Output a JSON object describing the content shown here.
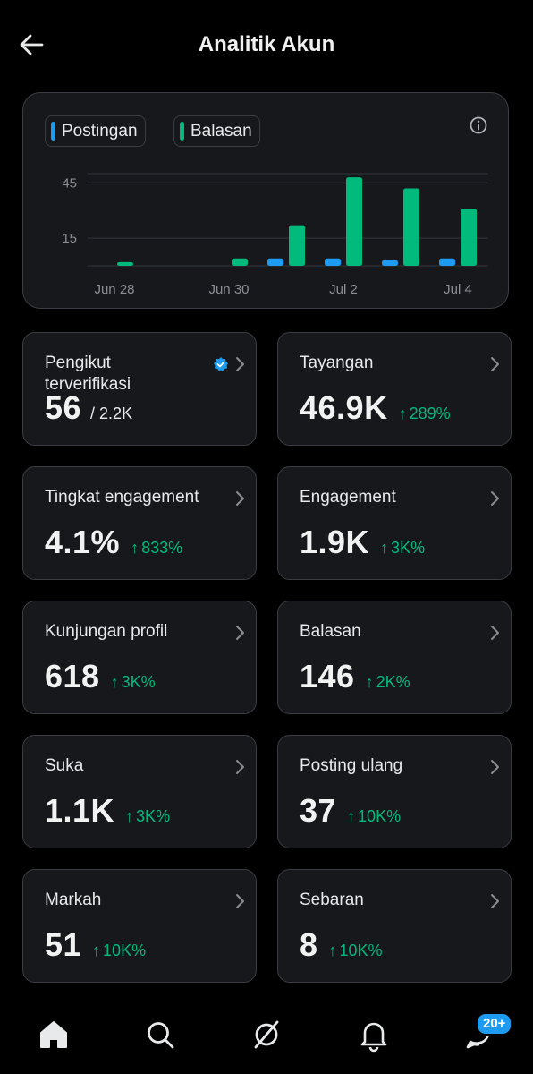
{
  "header": {
    "title": "Analitik Akun"
  },
  "chart_legend": {
    "posts_label": "Postingan",
    "replies_label": "Balasan"
  },
  "colors": {
    "posts": "#1d9bf0",
    "replies": "#00ba7c",
    "accent_green": "#00ba7c",
    "badge": "#1d9bf0"
  },
  "chart_data": {
    "type": "bar",
    "x": [
      "Jun 28",
      "Jun 29",
      "Jun 30",
      "Jul 1",
      "Jul 2",
      "Jul 3",
      "Jul 4"
    ],
    "tick_labels": [
      "Jun 28",
      "Jun 30",
      "Jul 2",
      "Jul 4"
    ],
    "y_ticks": [
      15,
      45
    ],
    "ylim": [
      0,
      50
    ],
    "grid": true,
    "legend_position": "top-left",
    "series": [
      {
        "name": "Postingan",
        "values": [
          0,
          0,
          0,
          4,
          4,
          3,
          4
        ]
      },
      {
        "name": "Balasan",
        "values": [
          2,
          0,
          4,
          22,
          48,
          42,
          31
        ]
      }
    ]
  },
  "cards": [
    {
      "label": "Pengikut terverifikasi",
      "value": "56",
      "sub": "/ 2.2K",
      "verified": true
    },
    {
      "label": "Tayangan",
      "value": "46.9K",
      "change": "289%"
    },
    {
      "label": "Tingkat engagement",
      "value": "4.1%",
      "change": "833%"
    },
    {
      "label": "Engagement",
      "value": "1.9K",
      "change": "3K%"
    },
    {
      "label": "Kunjungan profil",
      "value": "618",
      "change": "3K%"
    },
    {
      "label": "Balasan",
      "value": "146",
      "change": "2K%"
    },
    {
      "label": "Suka",
      "value": "1.1K",
      "change": "3K%"
    },
    {
      "label": "Posting ulang",
      "value": "37",
      "change": "10K%"
    },
    {
      "label": "Markah",
      "value": "51",
      "change": "10K%"
    },
    {
      "label": "Sebaran",
      "value": "8",
      "change": "10K%"
    }
  ],
  "nav": {
    "messages_badge": "20+"
  }
}
